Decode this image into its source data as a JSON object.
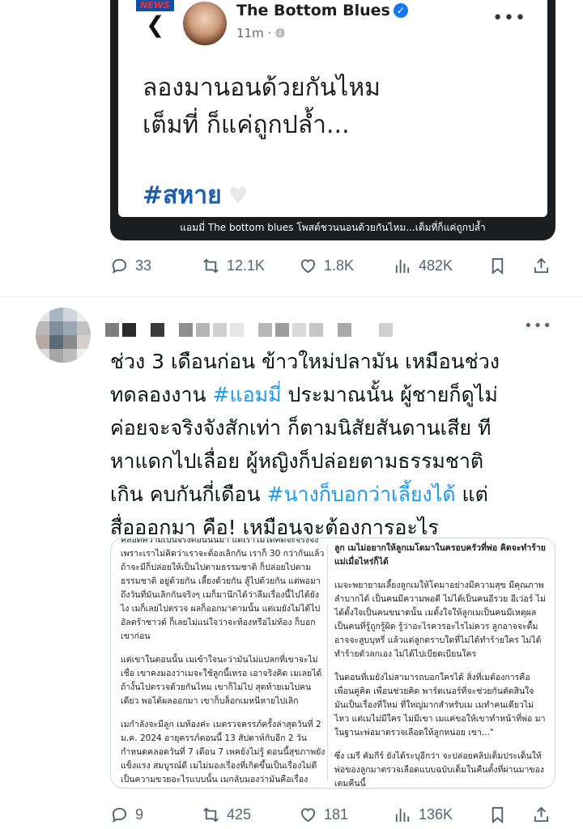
{
  "post1": {
    "embed": {
      "news_logo": "NEWS",
      "page_name": "The Bottom Blues",
      "time": "11m",
      "text_line1": "ลองมานอนด้วยกันไหม",
      "text_line2": "เต็มที่ ก็แค่ถูกปล้ำ...",
      "hashtag": "#สหาย",
      "caption": "แอมมี่ The bottom blues โพสต์ชวนนอนด้วยกันไหม...เต็มที่ก็แค่ถูกปล้ำ"
    },
    "stats": {
      "replies": "33",
      "reposts": "12.1K",
      "likes": "1.8K",
      "views": "482K"
    }
  },
  "post2": {
    "text": [
      "ช่วง 3 เดือนก่อน ข้าวใหม่ปลามัน เหมือนช่วง",
      "ทดลองงาน ",
      "#แอมมี่",
      " ประมาณนั้น ผู้ชายก็ดูไม่",
      "ค่อยจะจริงจังสักเท่า ก็ตามนิสัยสันดานเสีย ที",
      "หาแดกไปเลื่อย ผู้หญิงก็ปล่อยตามธรรมชาติ",
      "เกิน คบกันกี่เดือน ",
      "#นางก็บอกว่าเลี้ยงได้",
      " แต่",
      "สื่อออกมา คือ! เหมือนจะต้องการอะไร"
    ],
    "document": {
      "left": [
        "คลอดความเป็นจริงตอนนั้นมา แต่เราไม่ได้คิดจะจริงจังเพราะเราไม่คิดว่าเราจะต้องเลิกกัน เราก็ 30 กว่ากันแล้ว ถ้าจะมีก็ปล่อยให้เป็นไปตามธรรมชาติ ก็ปล่อยไปตามธรรมชาติ อยู่ด้วยกัน เลี้ยงด้วยกัน สู้ไปด้วยกัน แต่พอมาถึงวันที่มันเลิกกันจริงๆ เมก็มานึกได้ว่าลืมเรื่องนี้ไปได้ยังไง เมก็เลยไปตรวจ ผลก็ออกมาตามนั้น แต่เมยังไม่ได้ไปอัลตร้าซาวด์ ก็เลยไม่แน่ใจว่าจะท้องหรือไม่ท้อง ก็บอกเขาก่อน",
        "แต่เขาในตอนนั้น เมเข้าใจนะว่ามันไม่แปลกที่เขาจะไม่เชื่อ เขาคงมองว่าเมจะใช้ลูกนี้เหรอ เอาจริงคิด เมเลยได้ ถ้างั้นไปตรวจด้วยกันไหม เขาก็ไม่ไป สุดท้ายเมไปคนเดียว พอได้ผลออกมา เขาก็บล็อกเมหนีหายไปเลิก",
        "เมกำลังจะมีลูก เมท้องค่ะ เมตรวจครรภ์ครั้งล่าสุดวันที่ 2 ม.ค. 2024 อายุครรภ์ตอนนี้ 13 สัปดาห์กับอีก 2 วัน กำหนดคลอดวันที่ 7 เดือน 7 เพคยังไม่รู้ ตอนนี้สุขภาพยังแข็งแรง สมบูรณ์ดี เมไม่มองเรื่องที่เกิดขึ้นเป็นเรื่องไม่ดี เป็นความขวยอะไรแบบนั้น เมกลับมองว่ามันคือเรื่อง"
      ],
      "right": [
        "ลูก เมไม่อยากให้ลูกเมโตมาในครอบครัวที่พ่อ คิดจะทำร้ายแม่เมื่อไหร่ก็ได้",
        "เมจะพยายามเลี้ยงลูกเมให้โตมาอย่างมีความสุข มีคุณภาพ ลำบากได้ เป็นคนมีความพอดี ไม่ได้เป็นคนอีรวย อีเว่อร์ ไม่ได้ตั้งใจเป็นคนขนาดนั้น เมตั้งใจให้ลูกเมเป็นคนมีเหตุผล เป็นคนที่รู้ถูกรู้ผิด รู้ว่าอะไรควรอะไรไม่ควร ลูกอาจจะดื้ม อาจจะสูบบุหรี่ แล้วแต่ลูกตราบใดที่ไม่ได้ทำร้ายใคร ไม่ได้ทำร้ายตัวลกเอง ไม่ได้ไปเบียดเบียนใคร",
        "ในตอนที่เมยังไม่สามารถบอกใครได้ สิ่งที่เมต้องการคือเพื่อนคู่คิด เพื่อนช่วยคิด พาร์ตเนอร์ที่จะช่วยกันตัดสินใจ มันเป็นเรื่องที่ใหม่ ที่ใหญ่มากสำหรับเม เมทำคนเดียวไม่ไหว แต่เมไม่มีใคร ไม่มีเขา เมแค่ขอให้เขาทำหน้าที่พ่อ มาในฐานะพ่อมาตรวจเลือดให้ลูกหน่อย เขา...\"",
        "ซึ่ง เมรี คัมกีร์ ยังได้ระบุอีกว่า จะปล่อยคลิปเต็มประเด็นให้พ่อของลูกมาตรวจเลือดแบบฉบับเต็มในคืนตั้งที่ผ่านมาของเตมคืนนี้"
      ]
    },
    "stats": {
      "replies": "9",
      "reposts": "425",
      "likes": "181",
      "views": "136K"
    }
  },
  "colors": {
    "accent": "#1d9bf0",
    "icon": "#536471",
    "text": "#0f1419"
  }
}
